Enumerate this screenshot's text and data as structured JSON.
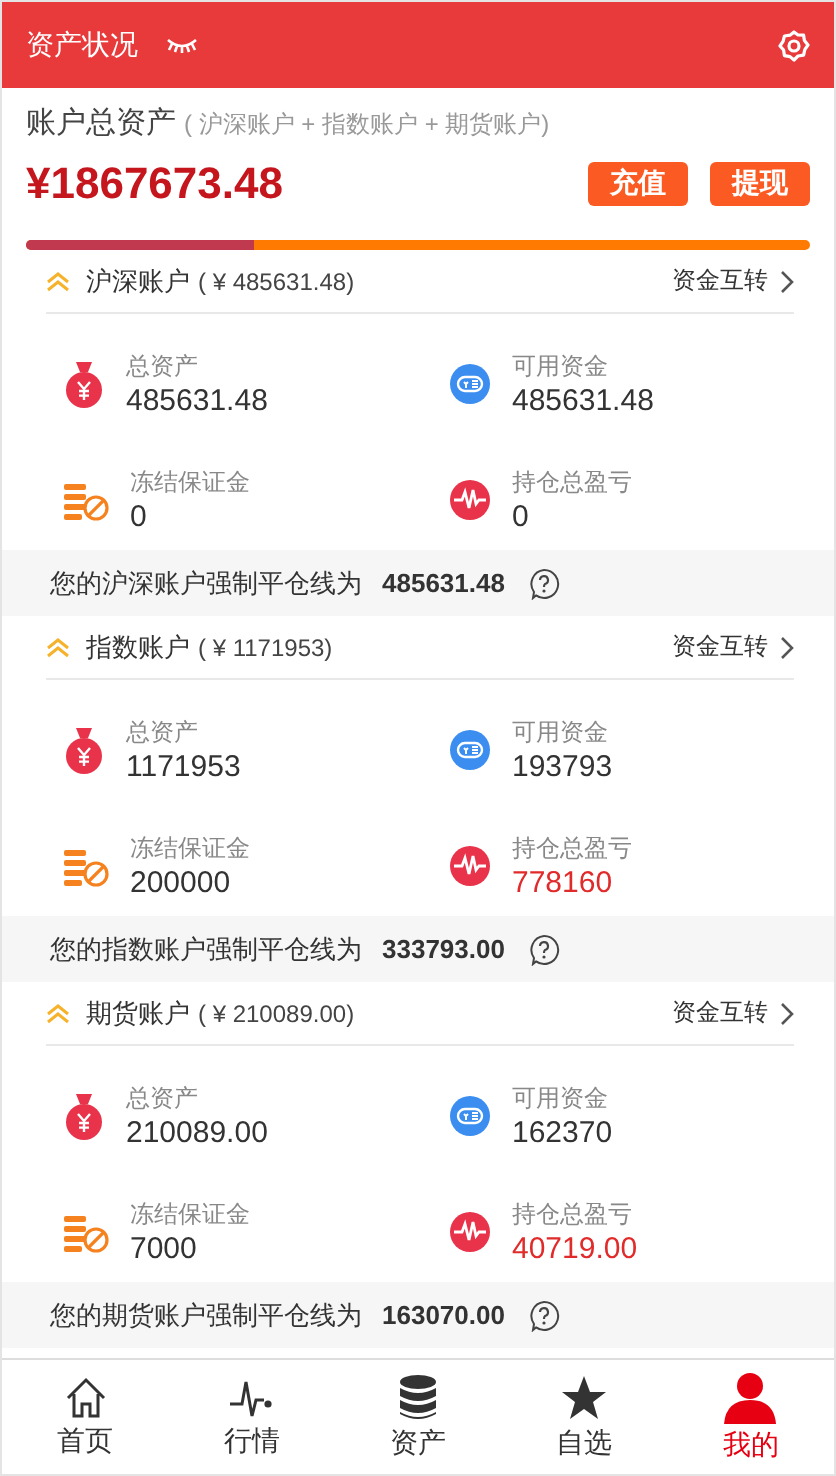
{
  "header": {
    "title": "资产状况"
  },
  "summary": {
    "label": "账户总资产",
    "note": "( 沪深账户 + 指数账户 + 期货账户)",
    "total": "¥1867673.48",
    "buttons": [
      "充值",
      "提现"
    ],
    "level": 0.29
  },
  "accounts": [
    {
      "name": "沪深账户",
      "amount": "( ¥ 485631.48)",
      "transfer": "资金互转",
      "stats": [
        {
          "kind": "total",
          "label": "总资产",
          "value": "485631.48",
          "highlight": false
        },
        {
          "kind": "available",
          "label": "可用资金",
          "value": "485631.48",
          "highlight": false
        },
        {
          "kind": "frozen",
          "label": "冻结保证金",
          "value": "0",
          "highlight": false
        },
        {
          "kind": "pnl",
          "label": "持仓总盈亏",
          "value": "0",
          "highlight": false
        }
      ],
      "line_label": "您的沪深账户强制平仓线为",
      "line_value": "485631.48"
    },
    {
      "name": "指数账户",
      "amount": "( ¥ 1171953)",
      "transfer": "资金互转",
      "stats": [
        {
          "kind": "total",
          "label": "总资产",
          "value": "1171953",
          "highlight": false
        },
        {
          "kind": "available",
          "label": "可用资金",
          "value": "193793",
          "highlight": false
        },
        {
          "kind": "frozen",
          "label": "冻结保证金",
          "value": "200000",
          "highlight": false
        },
        {
          "kind": "pnl",
          "label": "持仓总盈亏",
          "value": "778160",
          "highlight": true
        }
      ],
      "line_label": "您的指数账户强制平仓线为",
      "line_value": "333793.00"
    },
    {
      "name": "期货账户",
      "amount": "( ¥ 210089.00)",
      "transfer": "资金互转",
      "stats": [
        {
          "kind": "total",
          "label": "总资产",
          "value": "210089.00",
          "highlight": false
        },
        {
          "kind": "available",
          "label": "可用资金",
          "value": "162370",
          "highlight": false
        },
        {
          "kind": "frozen",
          "label": "冻结保证金",
          "value": "7000",
          "highlight": false
        },
        {
          "kind": "pnl",
          "label": "持仓总盈亏",
          "value": "40719.00",
          "highlight": true
        }
      ],
      "line_label": "您的期货账户强制平仓线为",
      "line_value": "163070.00"
    }
  ],
  "nav": [
    {
      "kind": "home",
      "label": "首页",
      "selected": false
    },
    {
      "kind": "chart",
      "label": "行情",
      "selected": false
    },
    {
      "kind": "assets",
      "label": "资产",
      "selected": false
    },
    {
      "kind": "star",
      "label": "自选",
      "selected": false
    },
    {
      "kind": "user",
      "label": "我的",
      "selected": true
    }
  ]
}
